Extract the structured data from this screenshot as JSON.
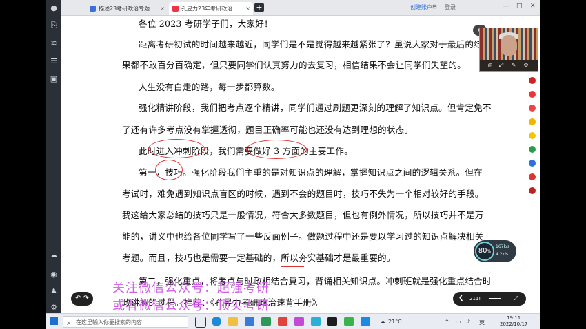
{
  "browser": {
    "tabs": [
      {
        "label": "描述23考研政治专题...",
        "active": false
      },
      {
        "label": "孔昱力23年考研政治...",
        "active": true
      }
    ],
    "new_tab_label": "+",
    "header_link": "创建账户",
    "header_item": "登录"
  },
  "document": {
    "greeting": "各位 2023 考研学子们，大家好！",
    "paragraphs": [
      "距离考研初试的时间越来越近，同学们是不是觉得越来越紧张了？虽说大家对于最后的结",
      "果都不敢百分百确定，但只要同学们认真努力的去复习，相信结果不会让同学们失望的。",
      "人生没有白走的路，每一步都算数。",
      "强化精讲阶段，我们把考点逐个精讲，同学们通过刷题更深刻的理解了知识点。但肯定免不",
      "了还有许多考点没有掌握透彻，题目正确率可能也还没有达到理想的状态。",
      "此时进入冲刺阶段，我们需要做好 3 方面的主要工作。",
      "第一，技巧。强化阶段我们主重的是对知识点的理解，掌握知识点之间的逻辑关系。但在",
      "考试时，难免遇到知识点盲区的时候，遇到不会的题目时，技巧不失为一个相对较好的手段。",
      "我这给大家总结的技巧只是一般情况，符合大多数题目，但也有例外情况，所以技巧并不是万",
      "能的，讲义中也给各位同学写了一些反面例子。做题过程中还是要以学习过的知识点解决相关",
      "考题。而且，技巧也是需要一定基础的，所以夯实基础才是最重要的。",
      "第二，强化重点，将考点与时政相结合复习，背诵相关知识点。冲刺班就是强化重点结合时",
      "政讲解的过程。推荐：《孔昱力考研政治速背手册》。"
    ]
  },
  "overlay": {
    "gauge_value": "80",
    "gauge_unit": "%",
    "upload_speed": "167k/s",
    "download_speed": "4.2k/s",
    "player_left": "↶ ↷",
    "player_time": "211!"
  },
  "watermark": {
    "line1": "关注微信公众号：超强考研",
    "line2": "或者微信公众号：顶尖考研"
  },
  "taskbar": {
    "search_placeholder": "在这里输入你要搜索的内容",
    "weather": "21°C",
    "ime": "英",
    "time": "19:11",
    "date": "2022/10/17"
  },
  "colors": {
    "accent": "#2f6fe0",
    "ink": "#dd3333",
    "watermark": "#d05fe6"
  }
}
